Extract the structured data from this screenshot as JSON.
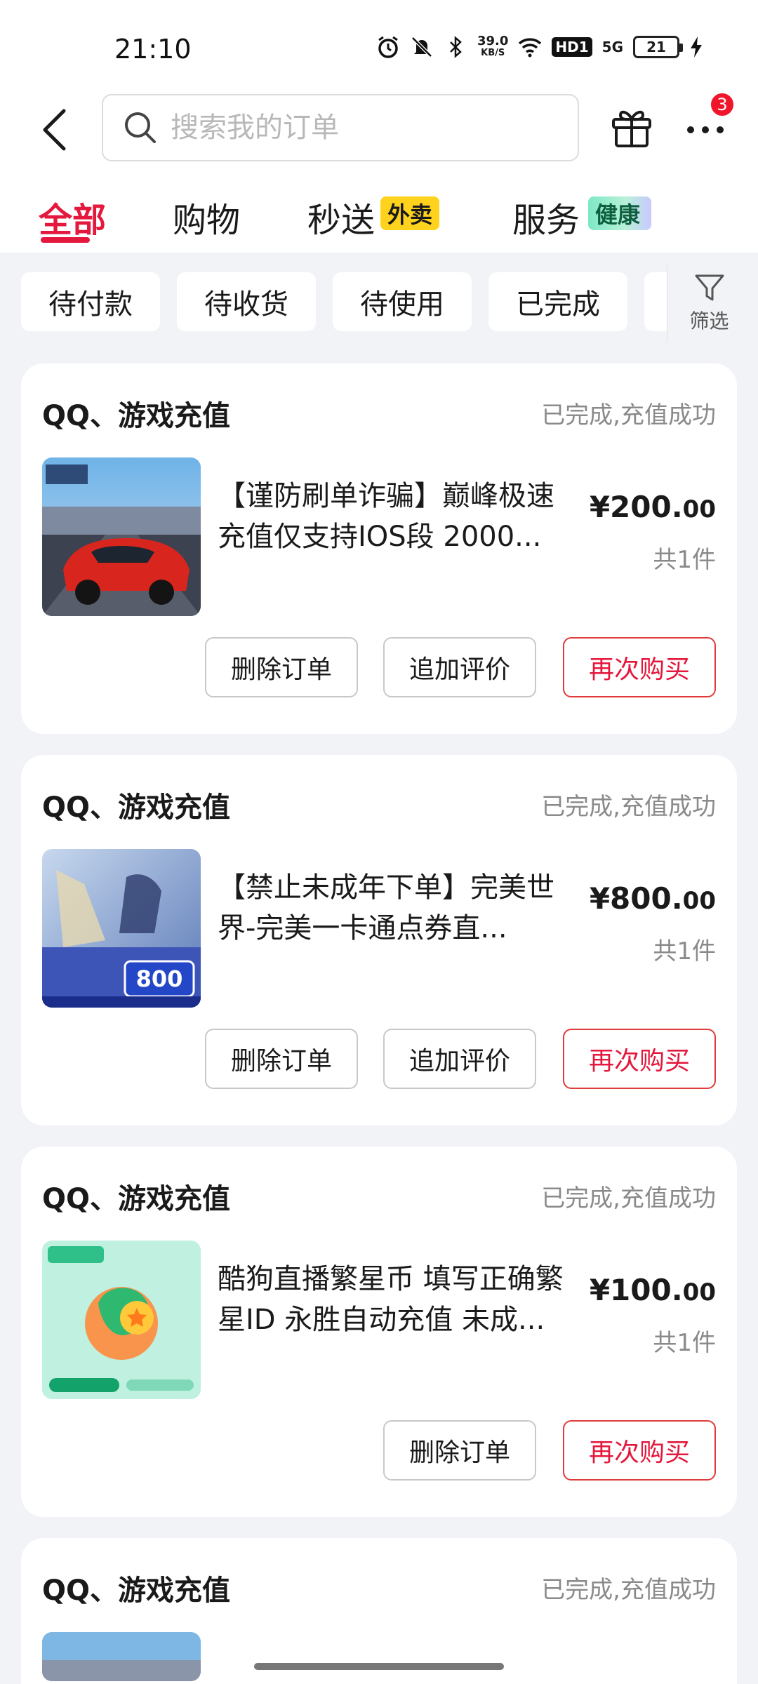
{
  "status_bar": {
    "time": "21:10",
    "speed_value": "39.0",
    "speed_unit": "KB/S",
    "hd_label": "HD1",
    "network": "5G",
    "battery": "21"
  },
  "header": {
    "search_placeholder": "搜索我的订单",
    "notification_count": "3"
  },
  "categories": {
    "all": "全部",
    "shopping": "购物",
    "express": "秒送",
    "express_tag": "外卖",
    "service": "服务",
    "service_tag": "健康"
  },
  "filters": {
    "chips": [
      "待付款",
      "待收货",
      "待使用",
      "已完成"
    ],
    "filter_label": "筛选"
  },
  "orders": [
    {
      "shop": "QQ、游戏充值",
      "status": "已完成,充值成功",
      "title": "【谨防刷单诈骗】巅峰极速充值仅支持IOS段 2000...",
      "price_int": "¥200.",
      "price_dec": "00",
      "qty": "共1件",
      "btn_delete": "删除订单",
      "btn_review": "追加评价",
      "btn_rebuy": "再次购买"
    },
    {
      "shop": "QQ、游戏充值",
      "status": "已完成,充值成功",
      "title": "【禁止未成年下单】完美世界-完美一卡通点券直...",
      "price_int": "¥800.",
      "price_dec": "00",
      "qty": "共1件",
      "btn_delete": "删除订单",
      "btn_review": "追加评价",
      "btn_rebuy": "再次购买",
      "thumb_amount": "800"
    },
    {
      "shop": "QQ、游戏充值",
      "status": "已完成,充值成功",
      "title": "酷狗直播繁星币 填写正确繁星ID 永胜自动充值 未成...",
      "price_int": "¥100.",
      "price_dec": "00",
      "qty": "共1件",
      "btn_delete": "删除订单",
      "btn_rebuy": "再次购买"
    },
    {
      "shop": "QQ、游戏充值",
      "status": "已完成,充值成功"
    }
  ]
}
